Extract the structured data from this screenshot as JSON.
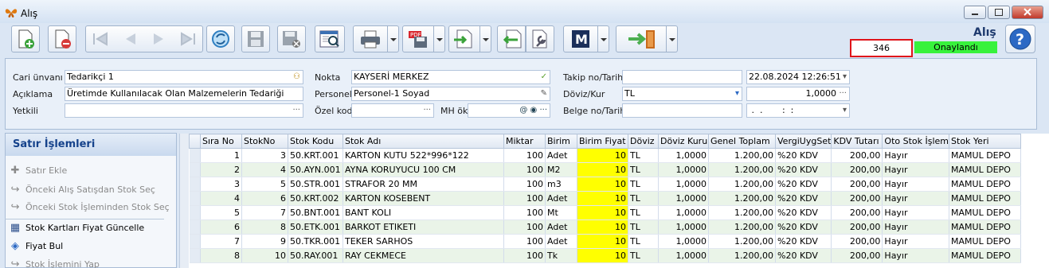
{
  "window": {
    "title": "Alış"
  },
  "header": {
    "form_title": "Alış",
    "doc_no": "346",
    "status": "Onaylandı"
  },
  "toolbar": {
    "icons": [
      "new-doc",
      "delete-doc",
      "first",
      "prev",
      "next",
      "last",
      "refresh",
      "save",
      "save-close",
      "preview",
      "print",
      "pdf-save",
      "export",
      "import",
      "tools",
      "m-menu",
      "exit"
    ]
  },
  "form": {
    "cari_unvani": {
      "label": "Cari ünvanı",
      "value": "Tedarikçi 1"
    },
    "aciklama": {
      "label": "Açıklama",
      "value": "Üretimde Kullanılacak Olan Malzemelerin Tedariği"
    },
    "yetkili": {
      "label": "Yetkili",
      "value": ""
    },
    "nokta": {
      "label": "Nokta",
      "value": "KAYSERİ MERKEZ"
    },
    "personel": {
      "label": "Personel",
      "value": "Personel-1 Soyad"
    },
    "ozel_kod": {
      "label": "Özel kod",
      "value": ""
    },
    "mh_ok": {
      "label": "MH ök",
      "value": ""
    },
    "takip": {
      "label": "Takip no/Tarih",
      "value": "",
      "date": "22.08.2024 12:26:51"
    },
    "doviz": {
      "label": "Döviz/Kur",
      "value": "TL",
      "kur": "1,0000"
    },
    "belge": {
      "label": "Belge no/Tarih",
      "value": "",
      "date": " .  .       :  :"
    }
  },
  "panel": {
    "title": "Satır İşlemleri",
    "items": [
      {
        "label": "Satır Ekle",
        "enabled": false
      },
      {
        "label": "Önceki Alış Satışdan Stok Seç",
        "enabled": false
      },
      {
        "label": "Önceki Stok İşleminden Stok Seç",
        "enabled": false
      },
      {
        "label": "Stok Kartları Fiyat Güncelle",
        "enabled": true
      },
      {
        "label": "Fiyat Bul",
        "enabled": true
      },
      {
        "label": "Stok İşlemini Yap",
        "enabled": false
      }
    ]
  },
  "grid": {
    "columns": [
      "Sıra No",
      "StokNo",
      "Stok Kodu",
      "Stok Adı",
      "Miktar",
      "Birim",
      "Birim Fiyat",
      "Döviz",
      "Döviz Kuru",
      "Genel Toplam",
      "VergiUygSet",
      "KDV Tutarı",
      "Oto Stok İşlem",
      "Stok Yeri"
    ],
    "rows": [
      [
        "1",
        "3",
        "50.KRT.001",
        "KARTON KUTU 522*996*122",
        "100",
        "Adet",
        "10",
        "TL",
        "1,0000",
        "1.200,00",
        "%20 KDV",
        "200,00",
        "Hayır",
        "MAMUL DEPO"
      ],
      [
        "2",
        "4",
        "50.AYN.001",
        "AYNA KORUYUCU 100 CM",
        "100",
        "M2",
        "10",
        "TL",
        "1,0000",
        "1.200,00",
        "%20 KDV",
        "200,00",
        "Hayır",
        "MAMUL DEPO"
      ],
      [
        "3",
        "5",
        "50.STR.001",
        "STRAFOR 20 MM",
        "100",
        "m3",
        "10",
        "TL",
        "1,0000",
        "1.200,00",
        "%20 KDV",
        "200,00",
        "Hayır",
        "MAMUL DEPO"
      ],
      [
        "4",
        "6",
        "50.KRT.002",
        "KARTON KOSEBENT",
        "100",
        "Adet",
        "10",
        "TL",
        "1,0000",
        "1.200,00",
        "%20 KDV",
        "200,00",
        "Hayır",
        "MAMUL DEPO"
      ],
      [
        "5",
        "7",
        "50.BNT.001",
        "BANT KOLI",
        "100",
        "Mt",
        "10",
        "TL",
        "1,0000",
        "1.200,00",
        "%20 KDV",
        "200,00",
        "Hayır",
        "MAMUL DEPO"
      ],
      [
        "6",
        "8",
        "50.ETK.001",
        "BARKOT ETIKETI",
        "100",
        "Adet",
        "10",
        "TL",
        "1,0000",
        "1.200,00",
        "%20 KDV",
        "200,00",
        "Hayır",
        "MAMUL DEPO"
      ],
      [
        "7",
        "9",
        "50.TKR.001",
        "TEKER SARHOS",
        "100",
        "Adet",
        "10",
        "TL",
        "1,0000",
        "1.200,00",
        "%20 KDV",
        "200,00",
        "Hayır",
        "MAMUL DEPO"
      ],
      [
        "8",
        "10",
        "50.RAY.001",
        "RAY CEKMECE",
        "100",
        "Tk",
        "10",
        "TL",
        "1,0000",
        "1.200,00",
        "%20 KDV",
        "200,00",
        "Hayır",
        "MAMUL DEPO"
      ]
    ]
  },
  "colors": {
    "highlight": "#ffff00",
    "status_bg": "#38f23c",
    "alt_row": "#eaf4e8",
    "doc_no_border": "#e0141a"
  }
}
